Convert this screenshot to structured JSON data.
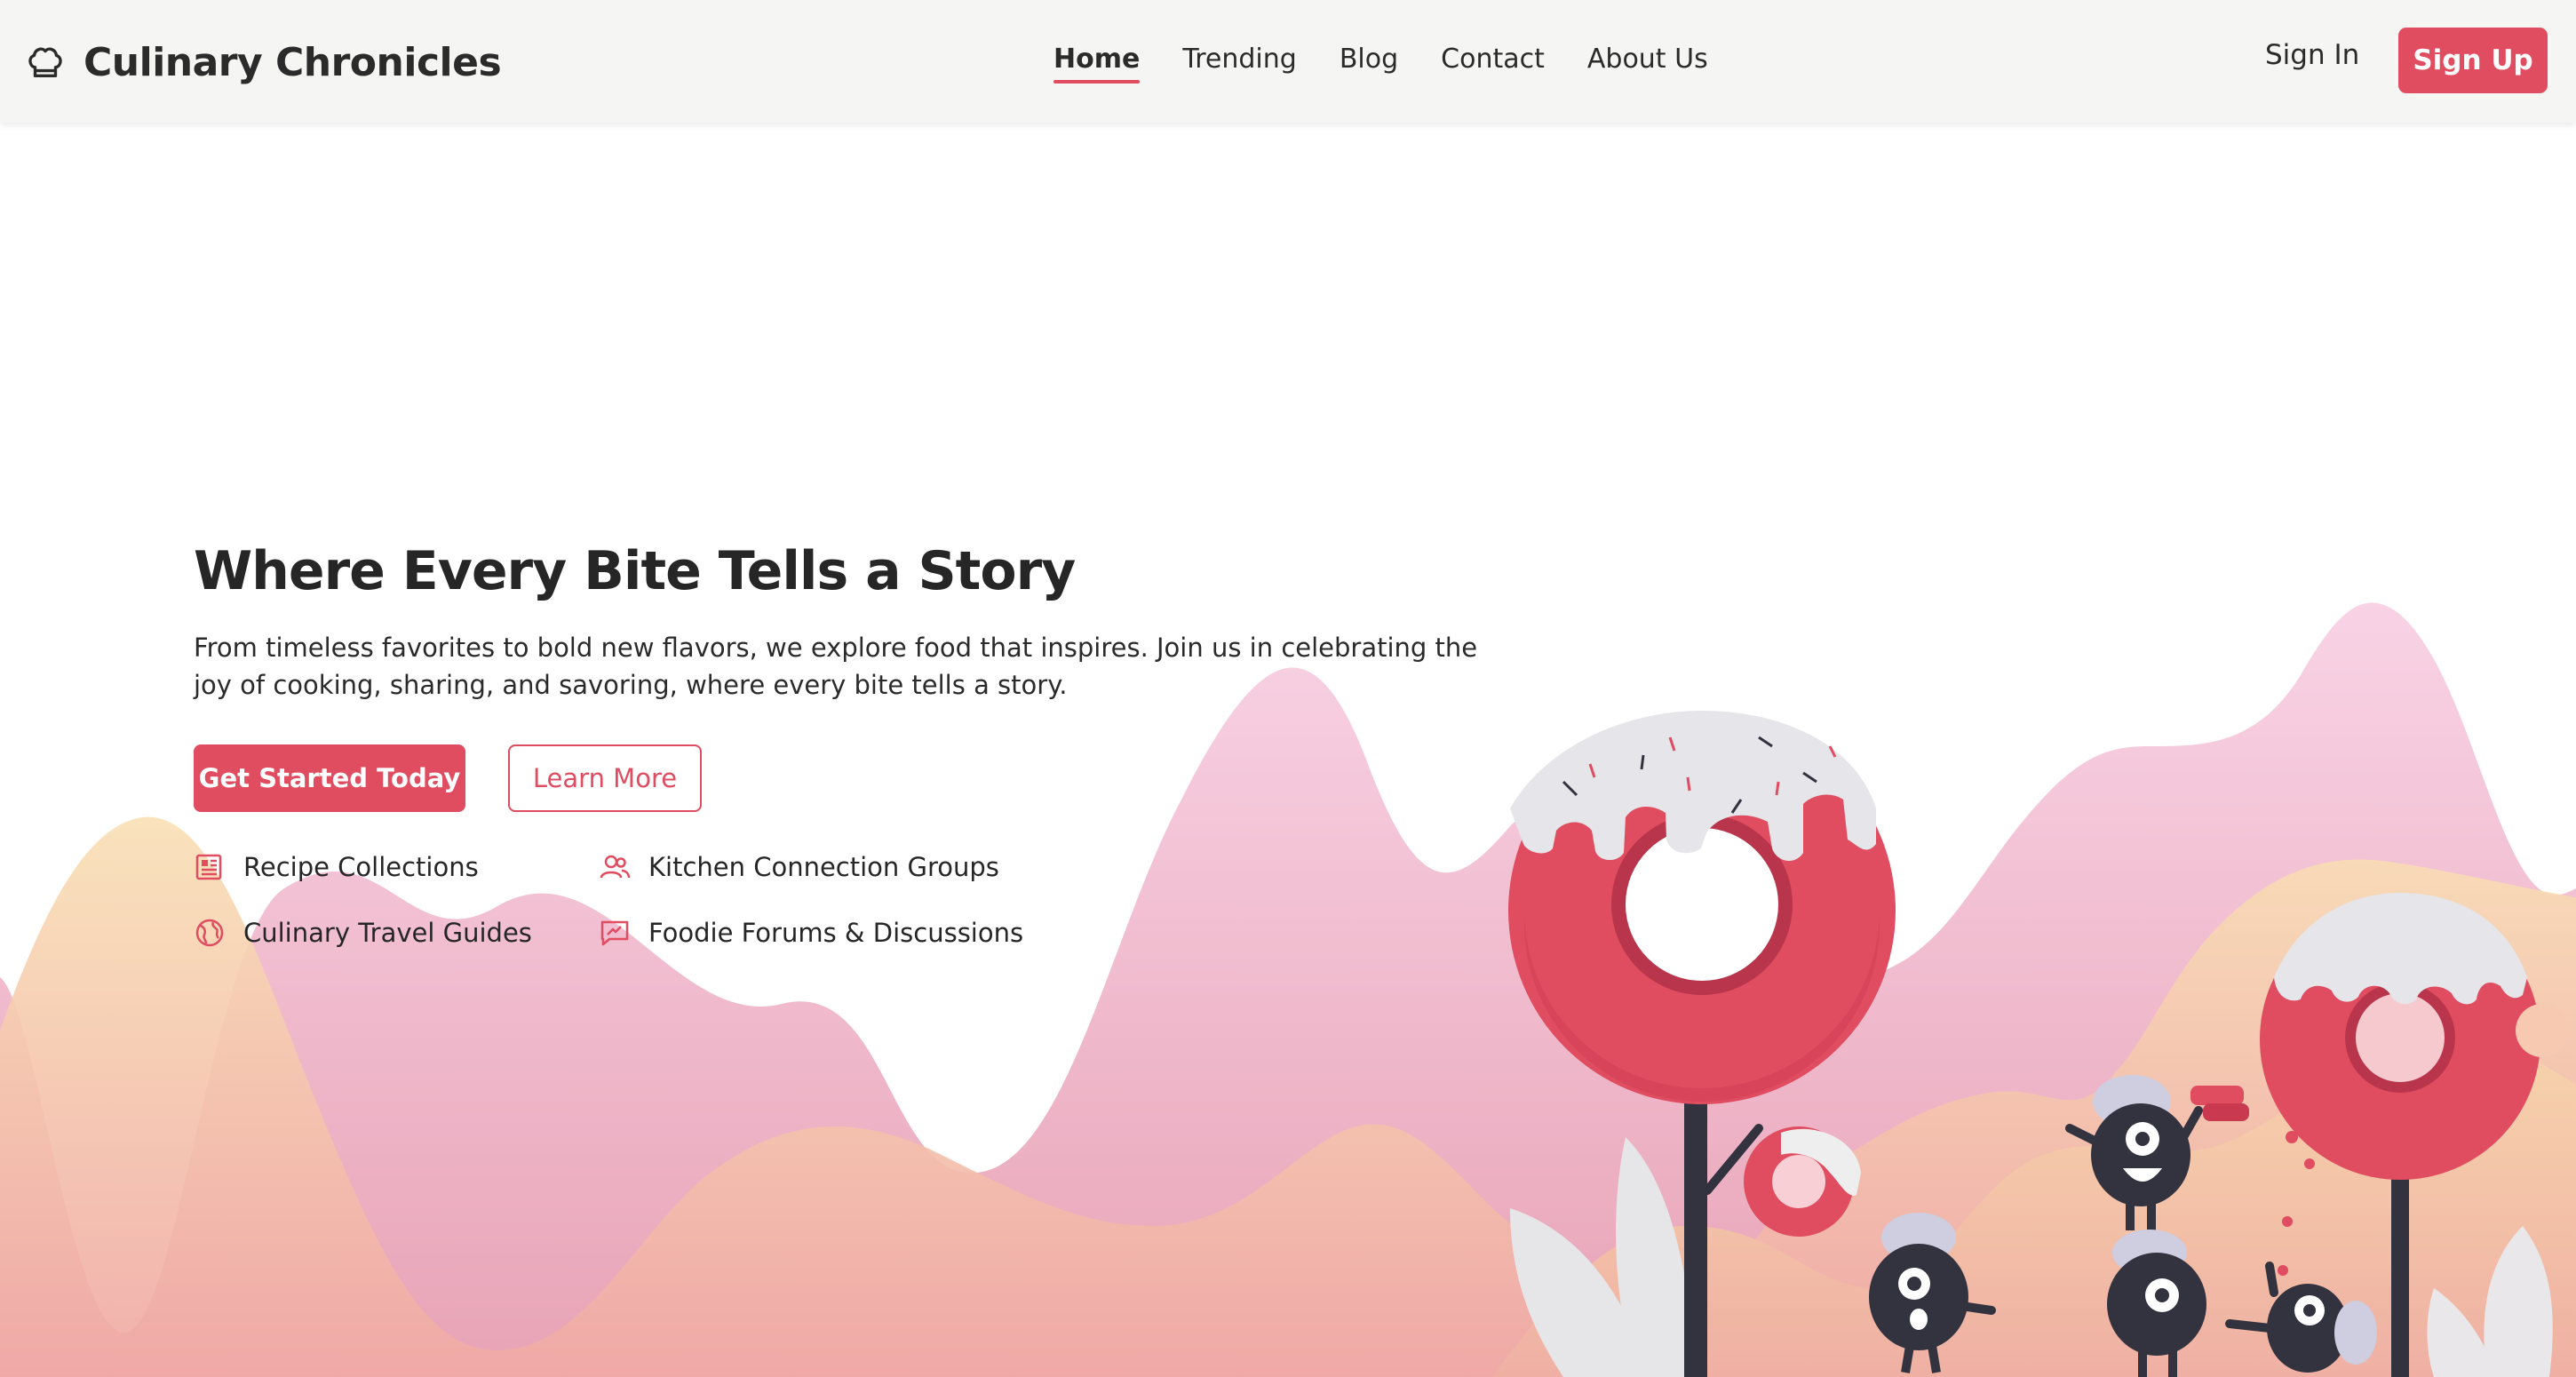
{
  "brand": {
    "name": "Culinary Chronicles",
    "icon": "chef-hat-icon"
  },
  "nav": {
    "items": [
      {
        "label": "Home",
        "active": true
      },
      {
        "label": "Trending",
        "active": false
      },
      {
        "label": "Blog",
        "active": false
      },
      {
        "label": "Contact",
        "active": false
      },
      {
        "label": "About Us",
        "active": false
      }
    ]
  },
  "auth": {
    "sign_in": "Sign In",
    "sign_up": "Sign Up"
  },
  "hero": {
    "title": "Where Every Bite Tells a Story",
    "subtitle": "From timeless favorites to bold new flavors, we explore food that inspires. Join us in celebrating the joy of cooking, sharing, and savoring, where every bite tells a story.",
    "primary_cta": "Get Started Today",
    "secondary_cta": "Learn More"
  },
  "features": [
    {
      "label": "Recipe Collections",
      "icon": "newspaper-icon"
    },
    {
      "label": "Kitchen Connection Groups",
      "icon": "users-icon"
    },
    {
      "label": "Culinary Travel Guides",
      "icon": "globe-icon"
    },
    {
      "label": "Foodie Forums & Discussions",
      "icon": "chat-icon"
    }
  ],
  "colors": {
    "accent": "#e04c60",
    "header_bg": "#f5f5f3",
    "text": "#262626",
    "mountain_pink": "#f2b3c4",
    "mountain_peach": "#f7cfa8",
    "character_dark": "#33323f"
  }
}
